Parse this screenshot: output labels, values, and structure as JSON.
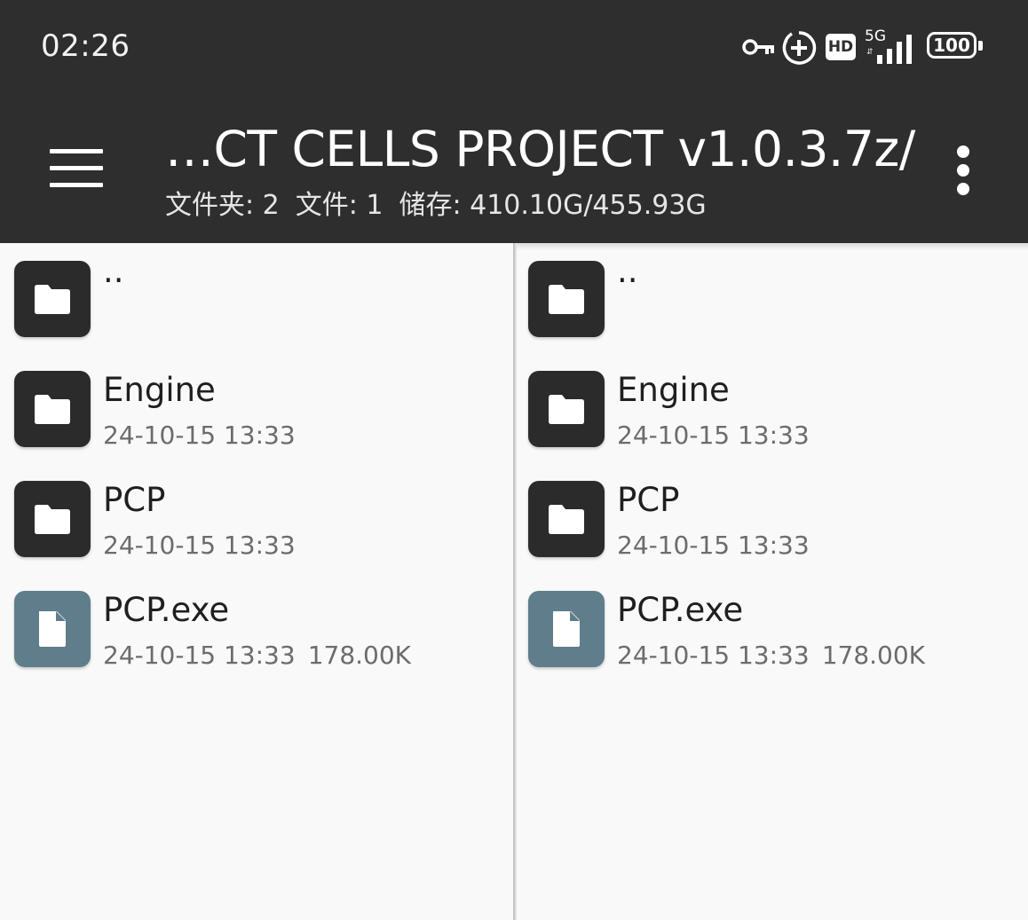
{
  "status_bar": {
    "time": "02:26",
    "icons": [
      "vpn-key-icon",
      "data-saver-icon",
      "hd-icon",
      "signal-5g-icon",
      "battery-icon"
    ],
    "hd_label": "HD",
    "network_label": "5G",
    "battery_level": "100"
  },
  "toolbar": {
    "menu_icon": "hamburger-menu-icon",
    "title": "…CT CELLS PROJECT v1.0.3.7z/",
    "folders_label": "文件夹: 2",
    "files_label": "文件: 1",
    "storage_label": "储存: 410.10G/455.93G",
    "more_icon": "more-vert-icon",
    "background_color": "#2e2e2e"
  },
  "panes": [
    {
      "items": [
        {
          "name": "..",
          "type": "parent",
          "date": "",
          "size": ""
        },
        {
          "name": "Engine",
          "type": "folder",
          "date": "24-10-15 13:33",
          "size": ""
        },
        {
          "name": "PCP",
          "type": "folder",
          "date": "24-10-15 13:33",
          "size": ""
        },
        {
          "name": "PCP.exe",
          "type": "file",
          "date": "24-10-15 13:33",
          "size": "178.00K"
        }
      ]
    },
    {
      "items": [
        {
          "name": "..",
          "type": "parent",
          "date": "",
          "size": ""
        },
        {
          "name": "Engine",
          "type": "folder",
          "date": "24-10-15 13:33",
          "size": ""
        },
        {
          "name": "PCP",
          "type": "folder",
          "date": "24-10-15 13:33",
          "size": ""
        },
        {
          "name": "PCP.exe",
          "type": "file",
          "date": "24-10-15 13:33",
          "size": "178.00K"
        }
      ]
    }
  ],
  "colors": {
    "folder_icon_bg": "#2b2b2b",
    "file_icon_bg": "#607d8b",
    "pane_bg": "#f9f9f9"
  }
}
